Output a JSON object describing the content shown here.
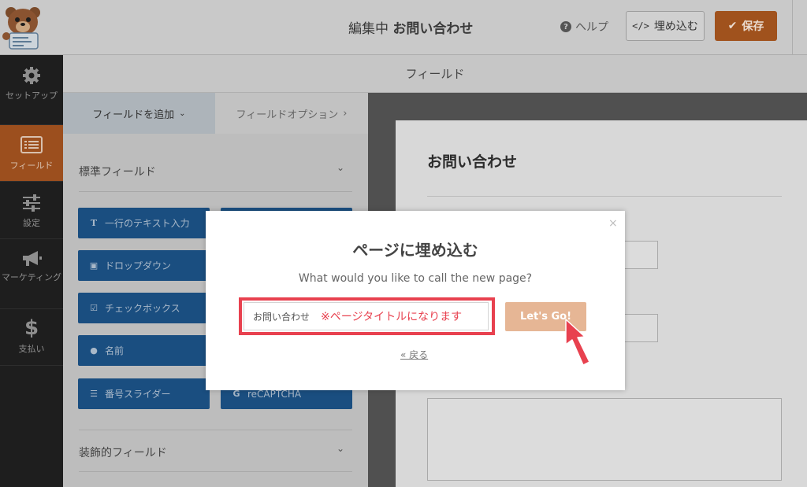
{
  "header": {
    "editing_prefix": "編集中",
    "form_name": "お問い合わせ",
    "help_label": "ヘルプ",
    "embed_label": "埋め込む",
    "save_label": "保存"
  },
  "sidebar": {
    "items": [
      {
        "label": "セットアップ",
        "icon": "gear-icon"
      },
      {
        "label": "フィールド",
        "icon": "form-list-icon",
        "active": true
      },
      {
        "label": "設定",
        "icon": "sliders-icon"
      },
      {
        "label": "マーケティング",
        "icon": "megaphone-icon"
      },
      {
        "label": "支払い",
        "icon": "dollar-icon"
      }
    ]
  },
  "fields_bar": {
    "title": "フィールド"
  },
  "panel": {
    "tab_add": "フィールドを追加",
    "tab_options": "フィールドオプション",
    "standard_section": "標準フィールド",
    "decorative_section": "装飾的フィールド",
    "buttons": [
      {
        "label": "一行のテキスト入力",
        "icon": "text-icon"
      },
      {
        "label": "ドロップダウン",
        "icon": "dropdown-icon"
      },
      {
        "label": "チェックボックス",
        "icon": "checkbox-icon"
      },
      {
        "label": "名前",
        "icon": "user-icon"
      },
      {
        "label": "番号スライダー",
        "icon": "sliders-icon"
      },
      {
        "label": "reCAPTCHA",
        "icon": "google-icon"
      }
    ]
  },
  "preview": {
    "form_title": "お問い合わせ"
  },
  "modal": {
    "title": "ページに埋め込む",
    "question": "What would you like to call the new page?",
    "input_value": "お問い合わせ",
    "annotation": "※ページタイトルになります",
    "go_label": "Let's Go!",
    "back_label": "« 戻る",
    "close": "×"
  },
  "colors": {
    "accent": "#e27730",
    "annotation_red": "#e8414f",
    "field_button": "#1a4e80",
    "go_button": "#e6b695"
  }
}
